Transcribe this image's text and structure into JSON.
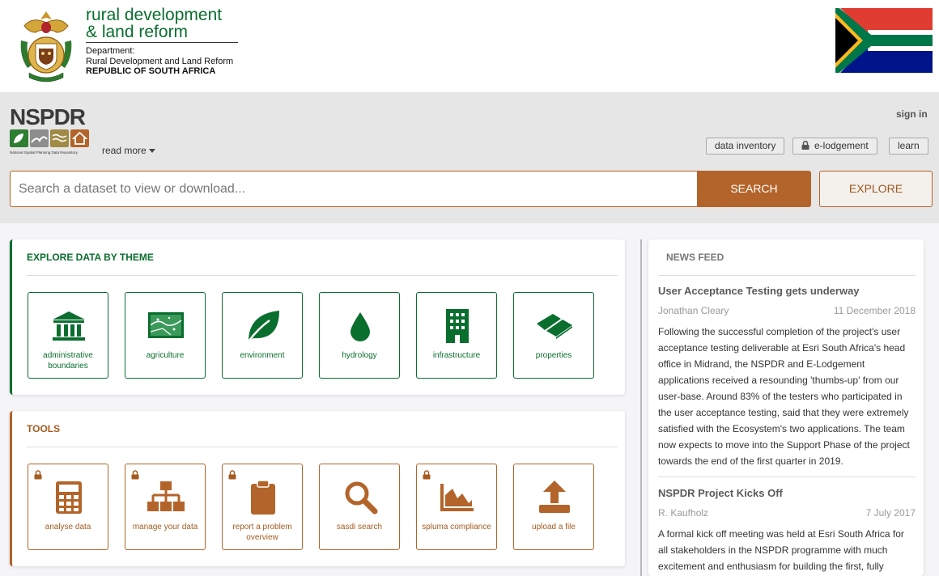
{
  "header": {
    "dept_line1": "rural development",
    "dept_line2": "& land reform",
    "sub_line1": "Department:",
    "sub_line2": "Rural Development and Land Reform",
    "sub_line3": "REPUBLIC OF SOUTH AFRICA"
  },
  "brand": {
    "name": "NSPDR",
    "caption": "National Spatial Planning Data Repository",
    "read_more": "read more"
  },
  "nav": {
    "sign_in": "sign in",
    "data_inventory": "data inventory",
    "e_lodgement": "e-lodgement",
    "learn": "learn"
  },
  "search": {
    "placeholder": "Search a dataset to view or download...",
    "search_label": "SEARCH",
    "explore_label": "EXPLORE"
  },
  "themes": {
    "title": "EXPLORE DATA BY THEME",
    "items": [
      {
        "label": "administrative boundaries",
        "icon": "bank-icon"
      },
      {
        "label": "agriculture",
        "icon": "map-icon"
      },
      {
        "label": "environment",
        "icon": "leaf-icon"
      },
      {
        "label": "hydrology",
        "icon": "water-drop-icon"
      },
      {
        "label": "infrastructure",
        "icon": "building-icon"
      },
      {
        "label": "properties",
        "icon": "land-parcel-icon"
      }
    ]
  },
  "tools": {
    "title": "TOOLS",
    "items": [
      {
        "label": "analyse data",
        "icon": "calculator-icon",
        "locked": true
      },
      {
        "label": "manage your data",
        "icon": "sitemap-icon",
        "locked": true
      },
      {
        "label": "report a problem overview",
        "icon": "clipboard-icon",
        "locked": true
      },
      {
        "label": "sasdi search",
        "icon": "search-icon",
        "locked": false
      },
      {
        "label": "spluma compliance",
        "icon": "area-chart-icon",
        "locked": true
      },
      {
        "label": "upload a file",
        "icon": "upload-icon",
        "locked": false
      }
    ]
  },
  "news": {
    "title": "NEWS FEED",
    "articles": [
      {
        "headline": "User Acceptance Testing gets underway",
        "author": "Jonathan Cleary",
        "date": "11 December 2018",
        "body": "Following the successful completion of the project's user acceptance testing deliverable at Esri South Africa's head office in Midrand, the NSPDR and E-Lodgement applications received a resounding 'thumbs-up' from our user-base. Around 83% of the testers who participated in the user acceptance testing, said that they were extremely satisfied with the Ecosystem's two applications. The team now expects to move into the Support Phase of the project towards the end of the first quarter in 2019."
      },
      {
        "headline": "NSPDR Project Kicks Off",
        "author": "R. Kaufholz",
        "date": "7 July 2017",
        "body": "A formal kick off meeting was held at Esri South Africa for all stakeholders in the NSPDR programme with much excitement and enthusiasm for building the first, fully"
      }
    ]
  },
  "colors": {
    "green": "#0a6e2e",
    "brown": "#b3642a"
  }
}
